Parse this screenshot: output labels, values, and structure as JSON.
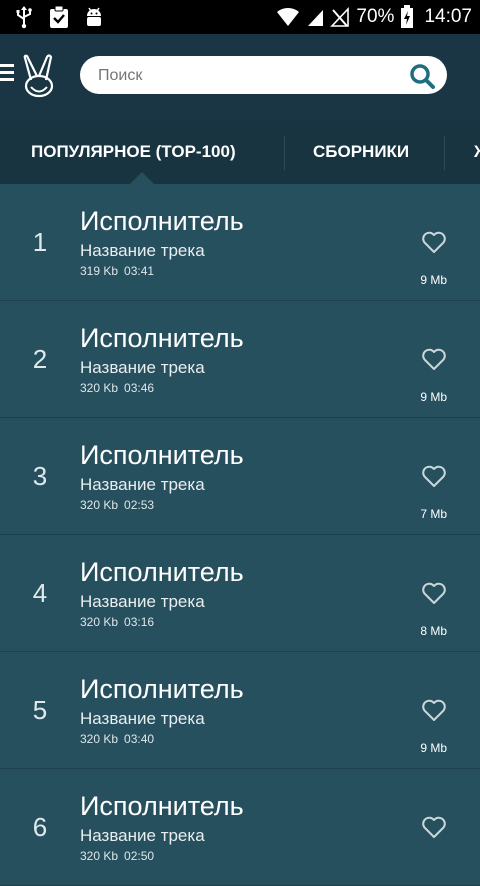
{
  "status_bar": {
    "battery": "70%",
    "time": "14:07"
  },
  "header": {
    "search_placeholder": "Поиск"
  },
  "tabs": [
    {
      "label": "ПОПУЛЯРНОЕ (TOP-100)",
      "selected": true
    },
    {
      "label": "СБОРНИКИ",
      "selected": false
    },
    {
      "label": "Ж",
      "selected": false
    }
  ],
  "tracks": [
    {
      "rank": "1",
      "artist": "Исполнитель",
      "title": "Название трека",
      "bitrate": "319 Kb",
      "duration": "03:41",
      "size": "9 Mb"
    },
    {
      "rank": "2",
      "artist": "Исполнитель",
      "title": "Название трека",
      "bitrate": "320 Kb",
      "duration": "03:46",
      "size": "9 Mb"
    },
    {
      "rank": "3",
      "artist": "Исполнитель",
      "title": "Название трека",
      "bitrate": "320 Kb",
      "duration": "02:53",
      "size": "7 Mb"
    },
    {
      "rank": "4",
      "artist": "Исполнитель",
      "title": "Название трека",
      "bitrate": "320 Kb",
      "duration": "03:16",
      "size": "8 Mb"
    },
    {
      "rank": "5",
      "artist": "Исполнитель",
      "title": "Название трека",
      "bitrate": "320 Kb",
      "duration": "03:40",
      "size": "9 Mb"
    },
    {
      "rank": "6",
      "artist": "Исполнитель",
      "title": "Название трека",
      "bitrate": "320 Kb",
      "duration": "02:50",
      "size": ""
    }
  ],
  "colors": {
    "background": "#27505f",
    "header": "#1a3644",
    "tabs": "#183440",
    "accent": "#1f6e80"
  },
  "icons": [
    "usb-icon",
    "clipboard-check-icon",
    "android-icon",
    "wifi-icon",
    "signal-icon",
    "no-signal-icon",
    "battery-charging-icon",
    "menu-icon",
    "bunny-logo-icon",
    "search-icon",
    "heart-icon"
  ]
}
